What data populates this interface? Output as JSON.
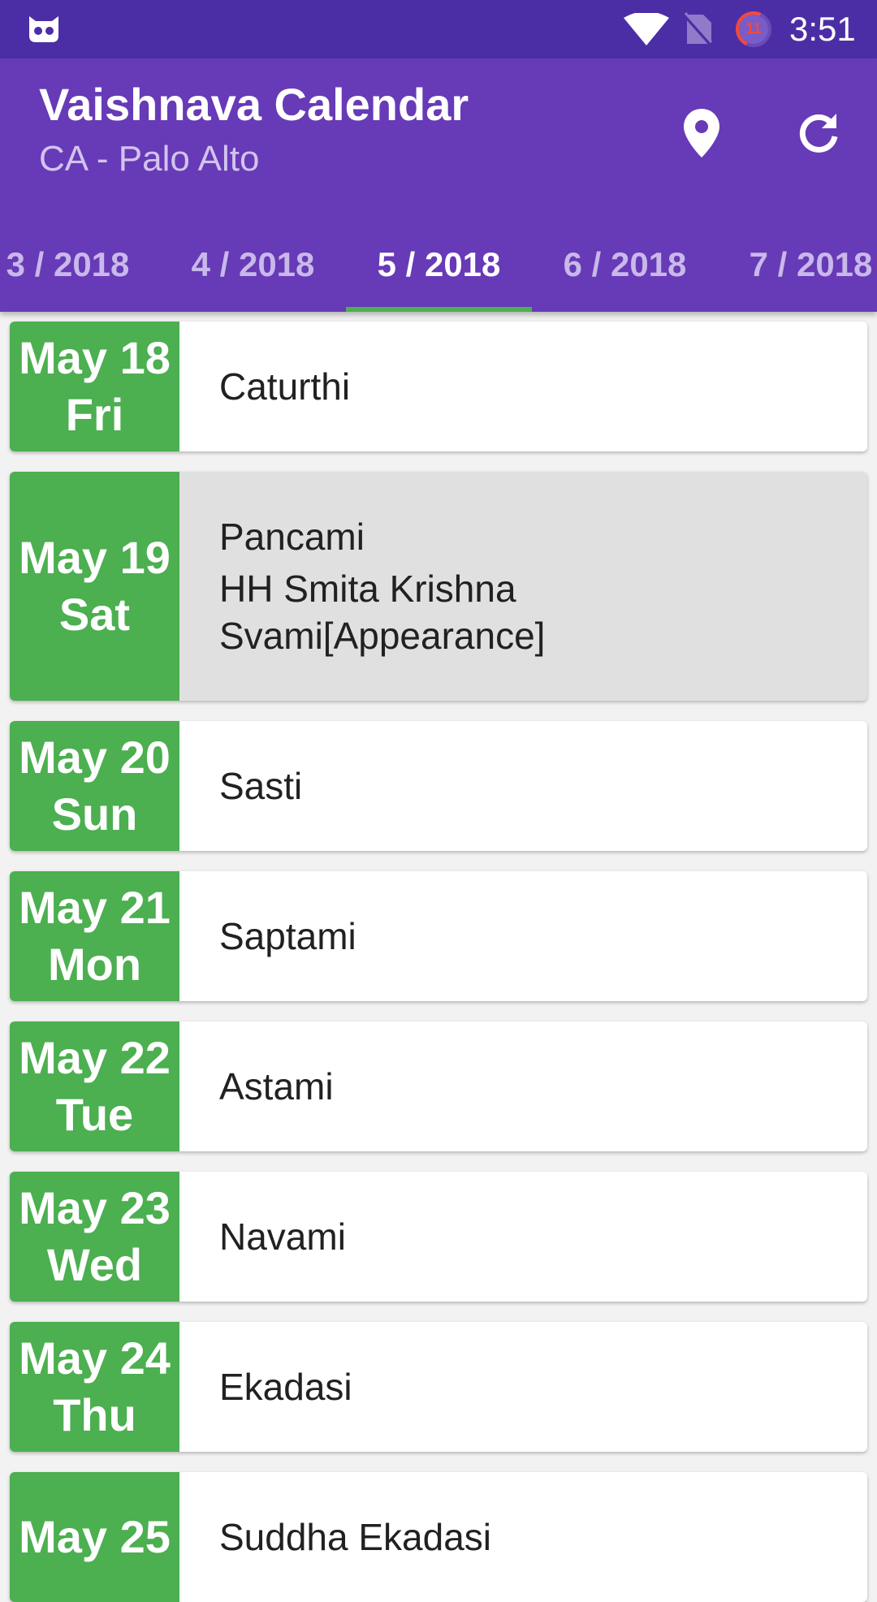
{
  "status_bar": {
    "app_icon": "cyanogen-face-icon",
    "wifi_icon": "wifi-icon",
    "sim_icon": "no-sim-icon",
    "notification_badge": "11",
    "time": "3:51"
  },
  "app_bar": {
    "title": "Vaishnava Calendar",
    "subtitle": "CA - Palo Alto",
    "location_icon": "location-pin-icon",
    "refresh_icon": "refresh-icon",
    "background_color": "#673ab7",
    "indicator_color": "#4caf50"
  },
  "tabs": [
    {
      "label": "3 / 2018"
    },
    {
      "label": "4 / 2018"
    },
    {
      "label": "5 / 2018",
      "active": true
    },
    {
      "label": "6 / 2018"
    },
    {
      "label": "7 / 2018"
    }
  ],
  "days": [
    {
      "date": "May 18",
      "weekday": "Fri",
      "events": [
        "Caturthi"
      ]
    },
    {
      "date": "May 19",
      "weekday": "Sat",
      "events": [
        "Pancami",
        "HH Smita Krishna Svami[Appearance]"
      ],
      "highlighted": true
    },
    {
      "date": "May 20",
      "weekday": "Sun",
      "events": [
        "Sasti"
      ]
    },
    {
      "date": "May 21",
      "weekday": "Mon",
      "events": [
        "Saptami"
      ]
    },
    {
      "date": "May 22",
      "weekday": "Tue",
      "events": [
        "Astami"
      ]
    },
    {
      "date": "May 23",
      "weekday": "Wed",
      "events": [
        "Navami"
      ]
    },
    {
      "date": "May 24",
      "weekday": "Thu",
      "events": [
        "Ekadasi"
      ]
    },
    {
      "date": "May 25",
      "weekday": "",
      "events": [
        "Suddha Ekadasi"
      ]
    }
  ],
  "colors": {
    "date_cell": "#4caf50",
    "status_bar": "#4b2ea5",
    "highlight_row": "#e0e0e0"
  }
}
